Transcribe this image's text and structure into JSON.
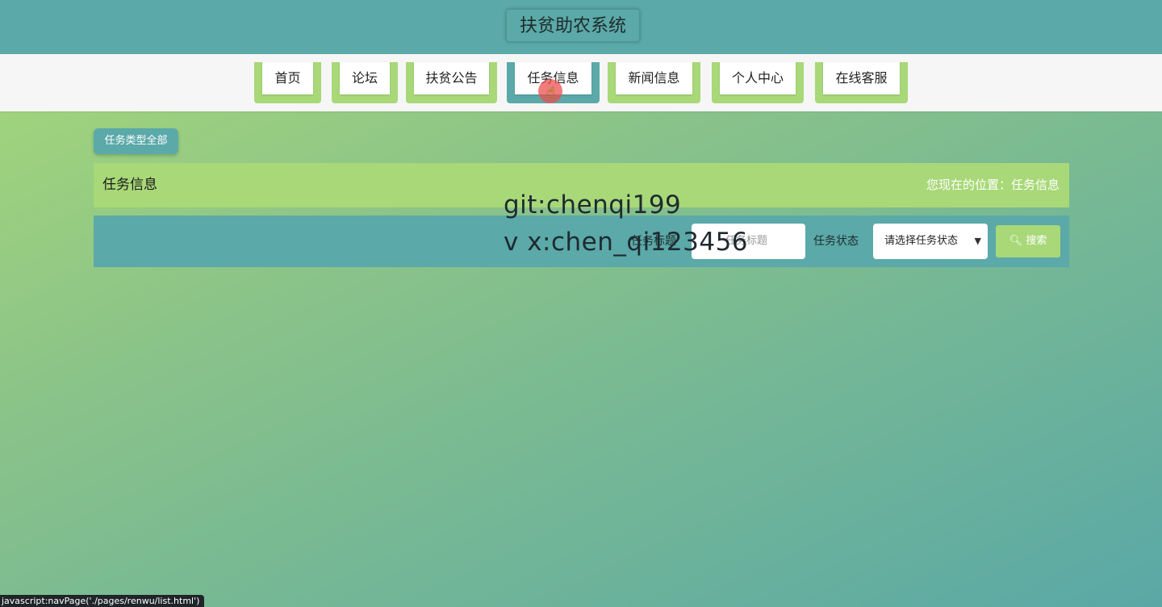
{
  "header": {
    "site_title": "扶贫助农系统"
  },
  "nav": {
    "items": [
      {
        "label": "首页"
      },
      {
        "label": "论坛"
      },
      {
        "label": "扶贫公告"
      },
      {
        "label": "任务信息"
      },
      {
        "label": "新闻信息"
      },
      {
        "label": "个人中心"
      },
      {
        "label": "在线客服"
      }
    ],
    "active": "任务信息"
  },
  "filter": {
    "type_tag": "任务类型全部"
  },
  "breadcrumb": {
    "title": "任务信息",
    "location": "您现在的位置：任务信息"
  },
  "search": {
    "title_label": "任务标题",
    "title_placeholder": "任务标题",
    "status_label": "任务状态",
    "status_selected": "请选择任务状态",
    "button_label": "搜索"
  },
  "watermark": {
    "line1": "git:chenqi199",
    "line2": "v x:chen_qi123456"
  },
  "statusbar": {
    "link": "javascript:navPage('./pages/renwu/list.html')"
  },
  "colors": {
    "teal": "#5ba9a9",
    "green": "#a8d878"
  }
}
